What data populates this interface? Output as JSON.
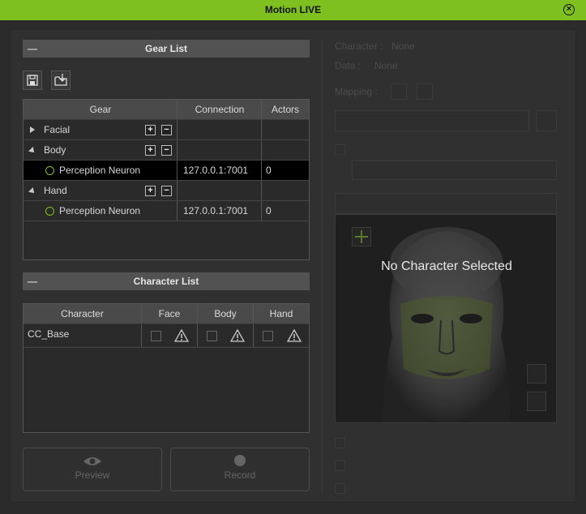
{
  "window": {
    "title": "Motion LIVE",
    "close_icon": "close-icon"
  },
  "gear_list": {
    "title": "Gear List",
    "toolbar": {
      "save_icon": "save-icon",
      "load_icon": "open-folder-icon"
    },
    "columns": [
      "Gear",
      "Connection",
      "Actors"
    ],
    "groups": [
      {
        "name": "Facial",
        "expanded": false,
        "items": []
      },
      {
        "name": "Body",
        "expanded": true,
        "items": [
          {
            "name": "Perception Neuron",
            "connection": "127.0.0.1:7001",
            "actors": "0",
            "selected": true
          }
        ]
      },
      {
        "name": "Hand",
        "expanded": true,
        "items": [
          {
            "name": "Perception Neuron",
            "connection": "127.0.0.1:7001",
            "actors": "0",
            "selected": false
          }
        ]
      }
    ]
  },
  "character_list": {
    "title": "Character List",
    "columns": [
      "Character",
      "Face",
      "Body",
      "Hand"
    ],
    "rows": [
      {
        "name": "CC_Base"
      }
    ]
  },
  "buttons": {
    "preview": "Preview",
    "record": "Record"
  },
  "right_panel": {
    "character_label": "Character :",
    "character_value": "None",
    "data_label": "Data :",
    "data_value": "None",
    "mapping_label": "Mapping :",
    "no_character": "No Character Selected"
  },
  "colors": {
    "accent": "#7ec01f",
    "background": "#2b2b2b",
    "header": "#525252"
  }
}
